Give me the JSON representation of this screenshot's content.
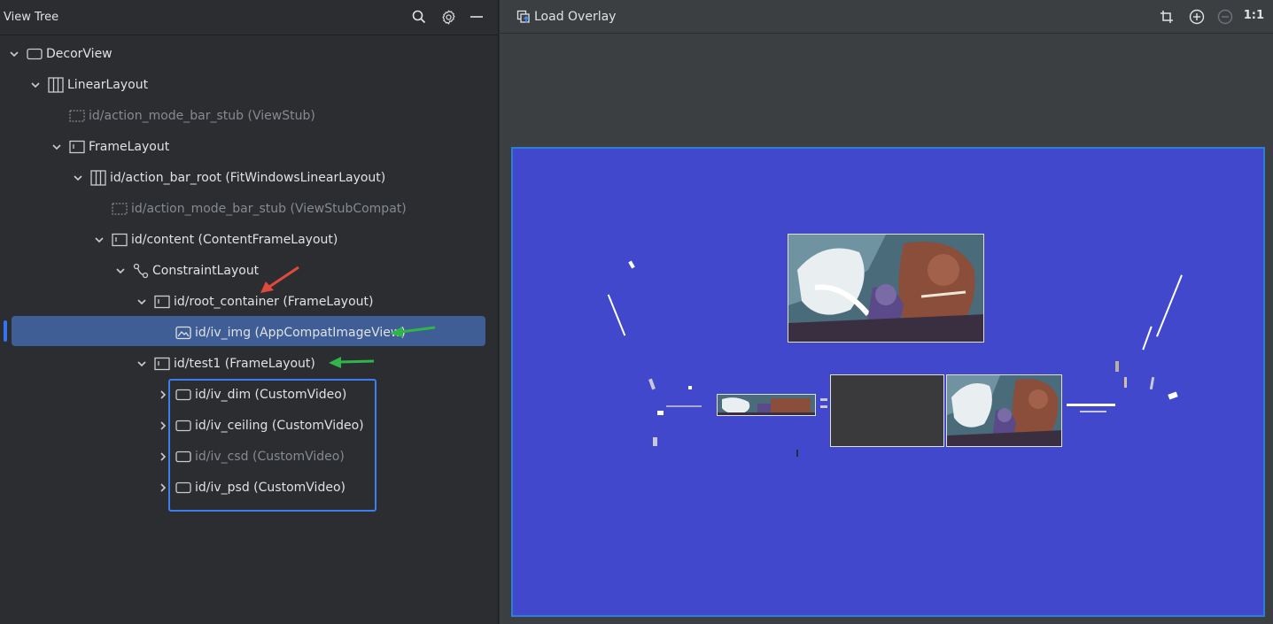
{
  "left_panel": {
    "title": "View Tree",
    "icons": [
      "search-icon",
      "gear-icon",
      "minimize-icon"
    ]
  },
  "tree": [
    {
      "label": "DecorView",
      "icon": "window-icon",
      "expanded": true,
      "dim": false
    },
    {
      "label": "LinearLayout",
      "icon": "linear-layout-icon",
      "expanded": true,
      "dim": false
    },
    {
      "label": "id/action_mode_bar_stub (ViewStub)",
      "icon": "viewstub-icon",
      "expanded": null,
      "dim": true
    },
    {
      "label": "FrameLayout",
      "icon": "frame-layout-icon",
      "expanded": true,
      "dim": false
    },
    {
      "label": "id/action_bar_root (FitWindowsLinearLayout)",
      "icon": "linear-layout-icon",
      "expanded": true,
      "dim": false
    },
    {
      "label": "id/action_mode_bar_stub (ViewStubCompat)",
      "icon": "viewstub-icon",
      "expanded": null,
      "dim": true
    },
    {
      "label": "id/content (ContentFrameLayout)",
      "icon": "frame-layout-icon",
      "expanded": true,
      "dim": false
    },
    {
      "label": "ConstraintLayout",
      "icon": "constraint-layout-icon",
      "expanded": true,
      "dim": false
    },
    {
      "label": "id/root_container (FrameLayout)",
      "icon": "frame-layout-icon",
      "expanded": true,
      "dim": false
    },
    {
      "label": "id/iv_img (AppCompatImageView)",
      "icon": "image-view-icon",
      "expanded": null,
      "dim": false,
      "selected": true
    },
    {
      "label": "id/test1 (FrameLayout)",
      "icon": "frame-layout-icon",
      "expanded": true,
      "dim": false
    },
    {
      "label": "id/iv_dim (CustomVideo)",
      "icon": "window-icon",
      "expanded": false,
      "dim": false
    },
    {
      "label": "id/iv_ceiling (CustomVideo)",
      "icon": "window-icon",
      "expanded": false,
      "dim": false
    },
    {
      "label": "id/iv_csd (CustomVideo)",
      "icon": "window-icon",
      "expanded": false,
      "dim": true
    },
    {
      "label": "id/iv_psd (CustomVideo)",
      "icon": "window-icon",
      "expanded": false,
      "dim": false
    }
  ],
  "right_panel": {
    "load_overlay_label": "Load Overlay",
    "zoom_label": "1:1",
    "icons": [
      "crop-icon",
      "zoom-in-icon",
      "zoom-out-icon"
    ],
    "canvas_color": "#4148cc"
  },
  "annotations": {
    "red_arrow_color": "#e04a3a",
    "green_arrow_color": "#2fb54a",
    "blue_box_color": "#3a7ff0"
  }
}
